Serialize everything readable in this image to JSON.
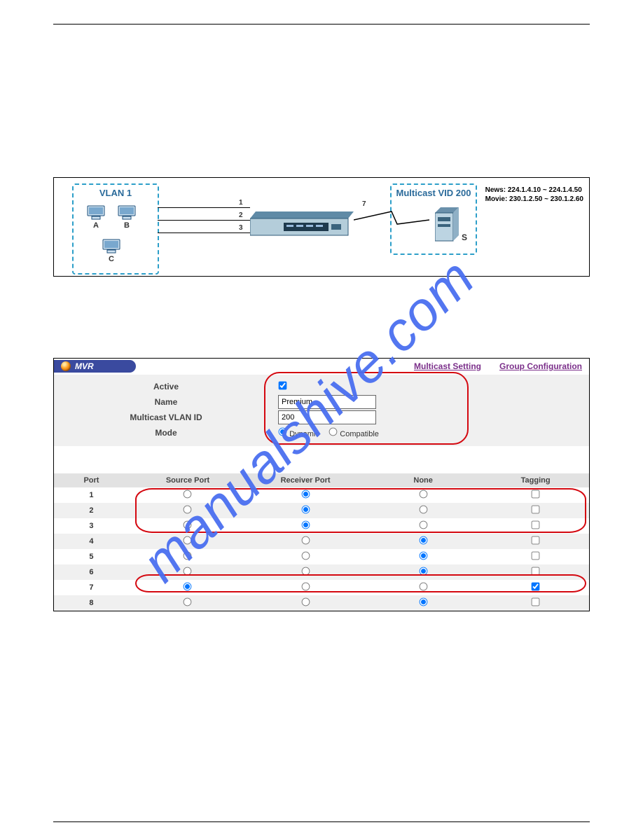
{
  "diagram": {
    "vlan_label": "VLAN 1",
    "mvid_label": "Multicast VID 200",
    "side_text_line1": "News: 224.1.4.10 ~ 224.1.4.50",
    "side_text_line2": "Movie: 230.1.2.50 ~ 230.1.2.60",
    "pc_a": "A",
    "pc_b": "B",
    "pc_c": "C",
    "server": "S",
    "p1": "1",
    "p2": "2",
    "p3": "3",
    "p7": "7"
  },
  "panel": {
    "title": "MVR",
    "links": {
      "multicast": "Multicast Setting",
      "group": "Group Configuration"
    },
    "form": {
      "active_label": "Active",
      "name_label": "Name",
      "vlan_label": "Multicast VLAN ID",
      "mode_label": "Mode",
      "name_value": "Premium",
      "vlan_value": "200",
      "mode_dynamic": "Dynamic",
      "mode_compatible": "Compatible"
    },
    "grid": {
      "headers": {
        "port": "Port",
        "source": "Source Port",
        "receiver": "Receiver Port",
        "none": "None",
        "tag": "Tagging"
      },
      "rows": [
        {
          "port": "1",
          "sel": "receiver",
          "tag": false
        },
        {
          "port": "2",
          "sel": "receiver",
          "tag": false
        },
        {
          "port": "3",
          "sel": "receiver",
          "tag": false
        },
        {
          "port": "4",
          "sel": "none",
          "tag": false
        },
        {
          "port": "5",
          "sel": "none",
          "tag": false
        },
        {
          "port": "6",
          "sel": "none",
          "tag": false
        },
        {
          "port": "7",
          "sel": "source",
          "tag": true
        },
        {
          "port": "8",
          "sel": "none",
          "tag": false
        }
      ]
    }
  }
}
